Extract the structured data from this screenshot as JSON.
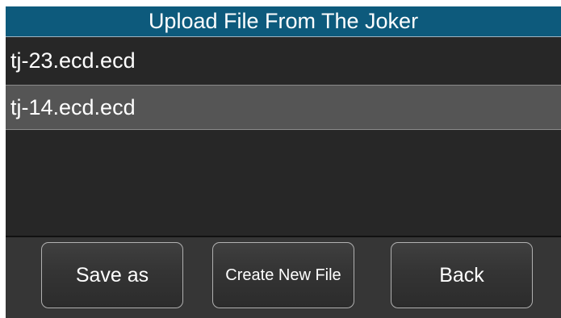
{
  "header": {
    "title": "Upload File From The Joker"
  },
  "file_list": {
    "items": [
      {
        "name": "tj-23.ecd.ecd",
        "selected": false
      },
      {
        "name": "tj-14.ecd.ecd",
        "selected": true
      }
    ]
  },
  "buttons": {
    "save_as": "Save as",
    "create_new_file": "Create New File",
    "back": "Back"
  },
  "colors": {
    "title_bar": "#0d5a7c",
    "background": "#2b2b2b",
    "selected_row": "#555555",
    "text": "#ffffff"
  }
}
